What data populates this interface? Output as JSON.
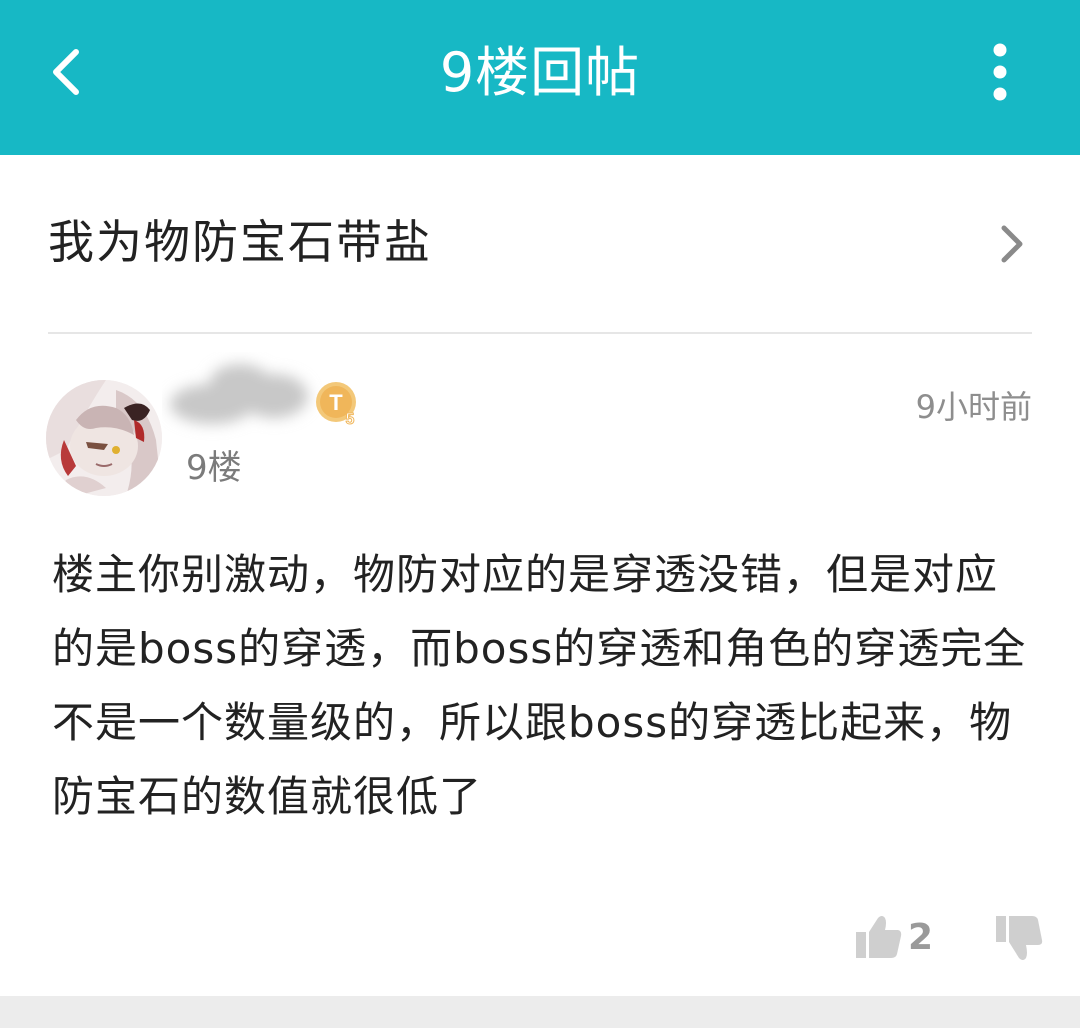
{
  "header": {
    "title": "9楼回帖",
    "back_icon": "chevron-left-icon",
    "more_icon": "more-vertical-icon",
    "bar_color": "#17b8c5"
  },
  "thread": {
    "title": "我为物防宝石带盐"
  },
  "post": {
    "floor": "9楼",
    "time": "9小时前",
    "badge_text": "T",
    "badge_level": "5",
    "content": "楼主你别激动，物防对应的是穿透没错，但是对应的是boss的穿透，而boss的穿透和角色的穿透完全不是一个数量级的，所以跟boss的穿透比起来，物防宝石的数值就很低了",
    "likes": "2"
  }
}
